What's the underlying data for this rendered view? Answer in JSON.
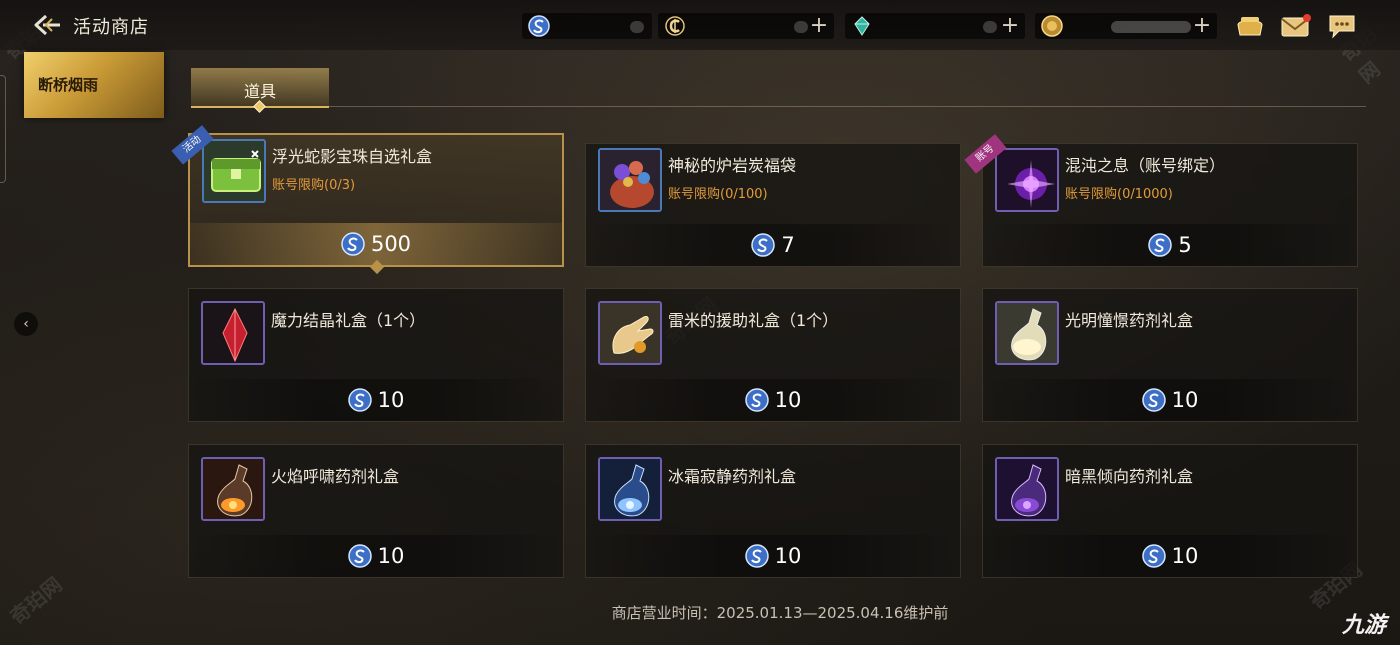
{
  "header": {
    "title": "活动商店"
  },
  "sidebar": {
    "active_tab": "断桥烟雨"
  },
  "category_tabs": [
    "道具"
  ],
  "items": [
    {
      "name": "浮光蛇影宝珠自选礼盒",
      "limit": "账号限购(0/3)",
      "price": "500",
      "badge": "活动",
      "thumb": "green-chest"
    },
    {
      "name": "神秘的炉岩炭福袋",
      "limit": "账号限购(0/100)",
      "price": "7",
      "badge": "",
      "thumb": "lucky-bag"
    },
    {
      "name": "混沌之息（账号绑定）",
      "limit": "账号限购(0/1000)",
      "price": "5",
      "badge": "账号",
      "thumb": "chaos-orb"
    },
    {
      "name": "魔力结晶礼盒（1个）",
      "limit": "",
      "price": "10",
      "badge": "",
      "thumb": "red-crystal"
    },
    {
      "name": "雷米的援助礼盒（1个）",
      "limit": "",
      "price": "10",
      "badge": "",
      "thumb": "gold-hand"
    },
    {
      "name": "光明憧憬药剂礼盒",
      "limit": "",
      "price": "10",
      "badge": "",
      "thumb": "light-potion"
    },
    {
      "name": "火焰呼啸药剂礼盒",
      "limit": "",
      "price": "10",
      "badge": "",
      "thumb": "fire-potion"
    },
    {
      "name": "冰霜寂静药剂礼盒",
      "limit": "",
      "price": "10",
      "badge": "",
      "thumb": "frost-potion"
    },
    {
      "name": "暗黑倾向药剂礼盒",
      "limit": "",
      "price": "10",
      "badge": "",
      "thumb": "dark-potion"
    }
  ],
  "footer": {
    "shop_time": "商店营业时间：2025.01.13—2025.04.16维护前",
    "brand": "九游"
  },
  "watermark": "奇珀网",
  "colors": {
    "accent_gold": "#d8b45c",
    "limit_orange": "#e19b3a",
    "currency_blue": "#4a7fd6"
  }
}
